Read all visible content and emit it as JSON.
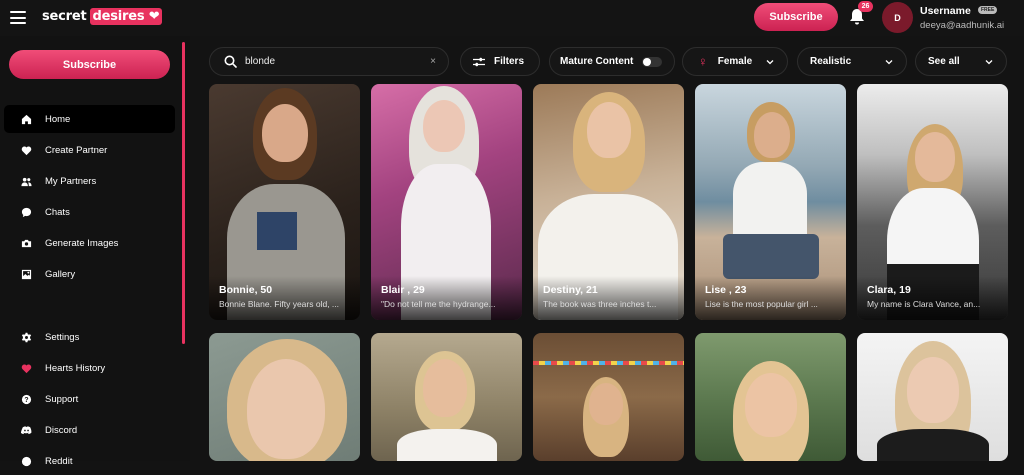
{
  "app": {
    "logo_text": "secret",
    "logo_badge": "desires",
    "subscribe_label": "Subscribe",
    "notification_count": "26",
    "avatar_initial": "D",
    "username": "Username",
    "plan_badge": "FREE",
    "email": "deeya@aadhunik.ai"
  },
  "sidebar": {
    "subscribe_label": "Subscribe",
    "items": [
      {
        "label": "Home",
        "icon": "home-icon",
        "active": true
      },
      {
        "label": "Create Partner",
        "icon": "heart-icon"
      },
      {
        "label": "My Partners",
        "icon": "users-icon"
      },
      {
        "label": "Chats",
        "icon": "chat-icon"
      },
      {
        "label": "Generate Images",
        "icon": "camera-icon"
      },
      {
        "label": "Gallery",
        "icon": "gallery-icon"
      },
      {
        "label": "Settings",
        "icon": "gear-icon"
      },
      {
        "label": "Hearts History",
        "icon": "heart-icon"
      },
      {
        "label": "Support",
        "icon": "help-icon"
      },
      {
        "label": "Discord",
        "icon": "discord-icon"
      },
      {
        "label": "Reddit",
        "icon": "reddit-icon"
      }
    ]
  },
  "filters": {
    "search_value": "blonde",
    "clear_symbol": "×",
    "filters_label": "Filters",
    "mature_label": "Mature Content",
    "mature_enabled": false,
    "gender_symbol": "♀",
    "gender_label": "Female",
    "style_label": "Realistic",
    "seeall_label": "See all"
  },
  "cards": [
    {
      "name": "Bonnie, 50",
      "desc": "Bonnie Blane. Fifty years old, ..."
    },
    {
      "name": "Blair , 29",
      "desc": "\"Do not tell me the hydrange..."
    },
    {
      "name": "Destiny, 21",
      "desc": "The book was three inches t..."
    },
    {
      "name": "Lise , 23",
      "desc": "Lise is the most popular girl ..."
    },
    {
      "name": "Clara, 19",
      "desc": "My name is Clara Vance, an..."
    },
    {
      "name": "",
      "desc": ""
    },
    {
      "name": "",
      "desc": ""
    },
    {
      "name": "",
      "desc": ""
    },
    {
      "name": "",
      "desc": ""
    },
    {
      "name": "",
      "desc": ""
    }
  ],
  "colors": {
    "accent": "#e8325f",
    "background": "#131313"
  }
}
